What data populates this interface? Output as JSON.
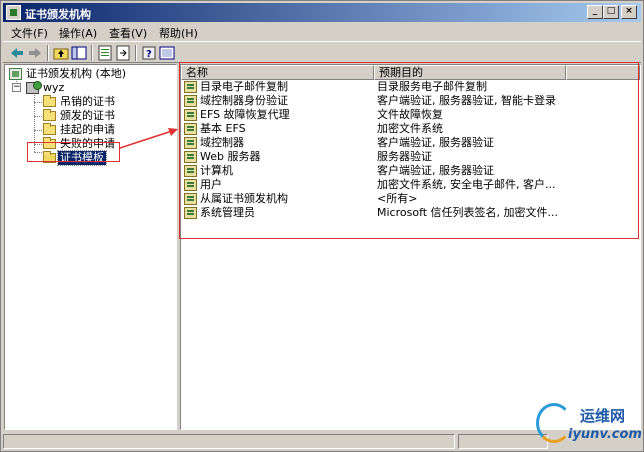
{
  "window": {
    "title": "证书颁发机构",
    "minimize": "_",
    "maximize": "□",
    "close": "×"
  },
  "menubar": {
    "items": [
      "文件(F)",
      "操作(A)",
      "查看(V)",
      "帮助(H)"
    ]
  },
  "toolbar": {
    "icons": [
      "back-arrow-icon",
      "forward-arrow-icon",
      "up-folder-icon",
      "show-tree-icon",
      "properties-icon",
      "export-list-icon",
      "help-icon",
      "console-icon"
    ]
  },
  "tree": {
    "root": "证书颁发机构 (本地)",
    "ca": "wyz",
    "children": [
      "吊销的证书",
      "颁发的证书",
      "挂起的申请",
      "失败的申请",
      "证书模板"
    ],
    "selected": "证书模板"
  },
  "list": {
    "columns": [
      "名称",
      "预期目的"
    ],
    "rows": [
      {
        "name": "目录电子邮件复制",
        "purpose": "目录服务电子邮件复制"
      },
      {
        "name": "域控制器身份验证",
        "purpose": "客户端验证, 服务器验证, 智能卡登录"
      },
      {
        "name": "EFS 故障恢复代理",
        "purpose": "文件故障恢复"
      },
      {
        "name": "基本 EFS",
        "purpose": "加密文件系统"
      },
      {
        "name": "域控制器",
        "purpose": "客户端验证, 服务器验证"
      },
      {
        "name": "Web 服务器",
        "purpose": "服务器验证"
      },
      {
        "name": "计算机",
        "purpose": "客户端验证, 服务器验证"
      },
      {
        "name": "用户",
        "purpose": "加密文件系统, 安全电子邮件, 客户..."
      },
      {
        "name": "从属证书颁发机构",
        "purpose": "<所有>"
      },
      {
        "name": "系统管理员",
        "purpose": "Microsoft 信任列表签名, 加密文件..."
      }
    ]
  },
  "watermark": {
    "top": "运维网",
    "bottom": "iyunv.com"
  },
  "colors": {
    "titlebar_start": "#0a246a",
    "titlebar_end": "#a6caf0",
    "selection": "#0a246a",
    "annotation": "#e03030"
  }
}
